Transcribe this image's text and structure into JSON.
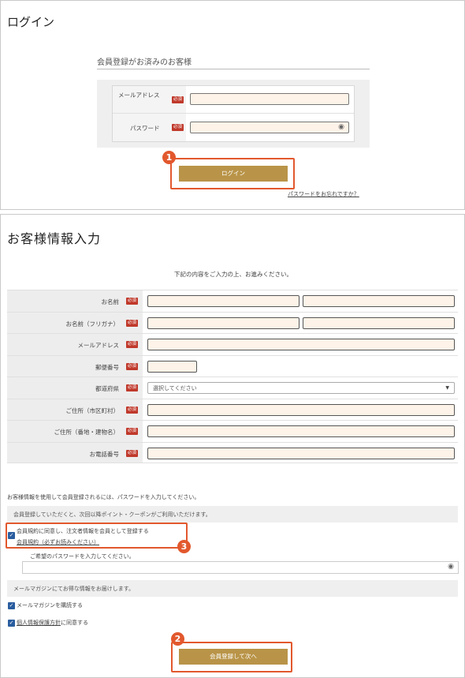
{
  "login": {
    "title": "ログイン",
    "section_heading": "会員登録がお済みのお客様",
    "email_label": "メールアドレス",
    "password_label": "パスワード",
    "required": "必須",
    "eye_icon": "eye-icon",
    "login_button": "ログイン",
    "forgot_link": "パスワードをお忘れですか？",
    "callout_number": "1"
  },
  "register": {
    "title": "お客様情報入力",
    "intro": "下記の内容をご入力の上、お進みください。",
    "required": "必須",
    "fields": {
      "name": "お名前",
      "name_kana": "お名前（フリガナ）",
      "email": "メールアドレス",
      "postal": "郵便番号",
      "prefecture": "都道府県",
      "city": "ご住所（市区町村）",
      "address": "ご住所（番地・建物名）",
      "phone": "お電話番号"
    },
    "prefecture_placeholder": "選択してください",
    "password_note": "お客様情報を使用して会員登録されるには、パスワードを入力してください。",
    "points_band": "会員登録していただくと、次回以降ポイント・クーポンがご利用いただけます。",
    "agree_member_text": "会員規約に同意し、注文者情報を会員として登録する",
    "member_terms_link": "会員規約（必ずお読みください）",
    "password_prompt": "ご希望のパスワードを入力してください。",
    "newsletter_band": "メールマガジンにてお得な情報をお届けします。",
    "newsletter_check": "メールマガジンを購読する",
    "privacy_link": "個人情報保護方針",
    "privacy_suffix": "に同意する",
    "submit_button": "会員登録して次へ",
    "callout_submit": "2",
    "callout_terms": "3"
  },
  "colors": {
    "gold": "#b99448",
    "callout": "#e2582d",
    "input_bg": "#fdf3e8",
    "checkbox": "#2a5d9f",
    "required_badge": "#c0392b"
  }
}
